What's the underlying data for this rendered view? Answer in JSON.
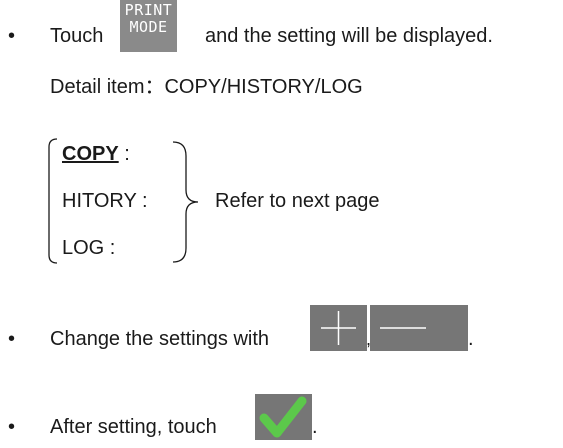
{
  "bullets": {
    "symbol": "•",
    "touch_prefix": "Touch",
    "touch_suffix": "and the setting will be displayed.",
    "detail_item": "Detail item：COPY/HISTORY/LOG",
    "change_settings": "Change the settings with",
    "change_suffix": ".",
    "after_setting": "After setting, touch",
    "after_suffix": "."
  },
  "print_mode_button": {
    "line1": "PRINT",
    "line2": "MODE"
  },
  "plus_minus_separator": ",",
  "items": [
    {
      "label": "COPY",
      "suffix": " :"
    },
    {
      "label": "HITORY",
      "suffix": " :"
    },
    {
      "label": "LOG",
      "suffix": " :"
    }
  ],
  "refer_text": "Refer to next page",
  "colors": {
    "button_gray": "#767676",
    "check_green": "#5cc84b"
  }
}
